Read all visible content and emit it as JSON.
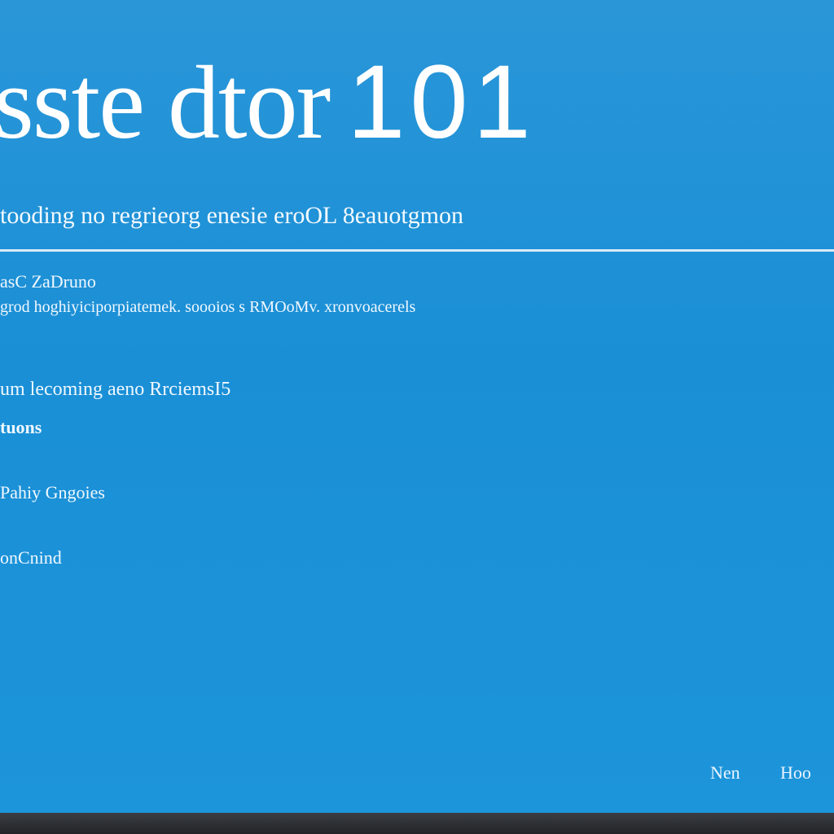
{
  "header": {
    "title_text": "sste dtor",
    "title_number": "101"
  },
  "subtitle": "tooding no regrieorg enesie eroOL 8eauotgmon",
  "lines": [
    "asC ZaDruno",
    "grod hoghiyiciporpiatemek. soooios s RMOoMv. xronvoacerels",
    "um lecoming aeno RrciemsI5",
    "tuons",
    "Pahiy Gngoies",
    "onCnind"
  ],
  "footer": {
    "next_label": "Nen",
    "help_label": "Hoo"
  },
  "colors": {
    "background": "#1a8fd6",
    "text": "#ffffff",
    "bezel": "#2a2c30"
  }
}
